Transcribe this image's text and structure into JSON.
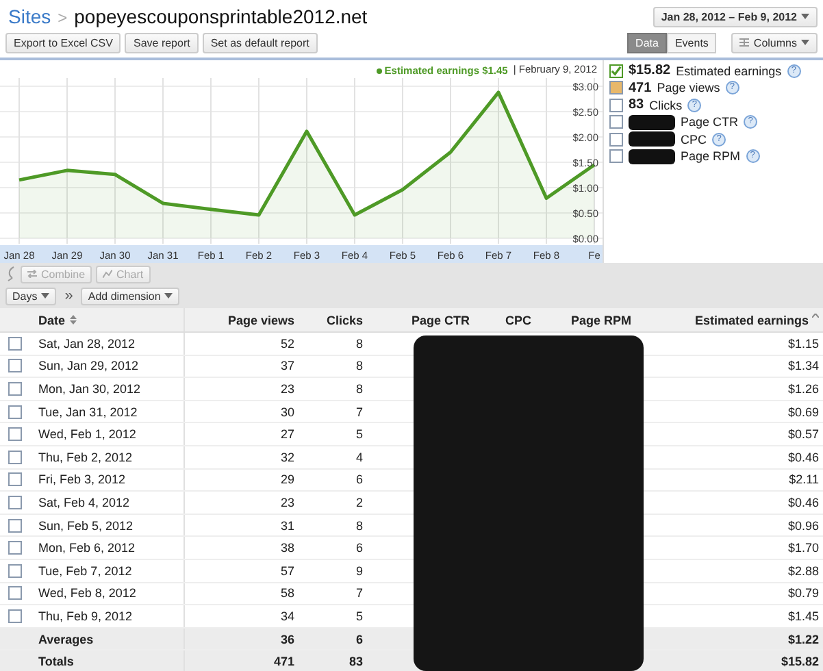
{
  "breadcrumb": {
    "root": "Sites",
    "separator": ">",
    "current": "popeyescouponsprintable2012.net"
  },
  "date_range": "Jan 28, 2012 – Feb 9, 2012",
  "actions": [
    "Export to Excel CSV",
    "Save report",
    "Set as default report"
  ],
  "view_tabs": [
    {
      "label": "Data",
      "selected": true
    },
    {
      "label": "Events",
      "selected": false
    }
  ],
  "columns_menu": "Columns",
  "chart": {
    "tooltip": {
      "value": "$1.45",
      "separator": "|",
      "date": "February 9, 2012"
    },
    "chart_data": {
      "type": "area",
      "grid": true,
      "categories": [
        "Jan 28",
        "Jan 29",
        "Jan 30",
        "Jan 31",
        "Feb 1",
        "Feb 2",
        "Feb 3",
        "Feb 4",
        "Feb 5",
        "Feb 6",
        "Feb 7",
        "Feb 8",
        "Fe"
      ],
      "series": [
        {
          "name": "Estimated earnings",
          "color": "#4e9a26",
          "values": [
            1.15,
            1.34,
            1.26,
            0.69,
            0.57,
            0.46,
            2.11,
            0.46,
            0.96,
            1.7,
            2.88,
            0.79,
            1.45
          ]
        }
      ],
      "ylim": [
        0,
        3
      ],
      "yticks": [
        {
          "value": 0,
          "label": "$0.00"
        },
        {
          "value": 0.5,
          "label": "$0.50"
        },
        {
          "value": 1,
          "label": "$1.00"
        },
        {
          "value": 1.5,
          "label": "$1.50"
        },
        {
          "value": 2,
          "label": "$2.00"
        },
        {
          "value": 2.5,
          "label": "$2.50"
        },
        {
          "value": 3,
          "label": "$3.00"
        }
      ]
    }
  },
  "legend": [
    {
      "value": "$15.82",
      "label": "Estimated earnings",
      "help": "?",
      "checked": true,
      "color": "#4e9a26",
      "redacted": false
    },
    {
      "value": "471",
      "label": "Page views",
      "help": "?",
      "checked": false,
      "color": "#e8b86a",
      "redacted": false
    },
    {
      "value": "83",
      "label": "Clicks",
      "help": "?",
      "checked": false,
      "redacted": false
    },
    {
      "label": "Page CTR",
      "help": "?",
      "checked": false,
      "redacted": true
    },
    {
      "label": "CPC",
      "help": "?",
      "checked": false,
      "redacted": true
    },
    {
      "label": "Page RPM",
      "help": "?",
      "checked": false,
      "redacted": true
    }
  ],
  "toolbar": {
    "combine": {
      "label": "Combine",
      "disabled": true
    },
    "chart": {
      "label": "Chart",
      "disabled": true
    },
    "dimension": "Days",
    "separator": "»",
    "add_dimension": "Add dimension"
  },
  "table": {
    "columns": [
      "Date",
      "Page views",
      "Clicks",
      "Page CTR",
      "CPC",
      "Page RPM",
      "Estimated earnings"
    ],
    "rows": [
      {
        "kind": "day",
        "checked": false,
        "date": "Sat, Jan 28, 2012",
        "page_views": "52",
        "clicks": "8",
        "earnings": "$1.15"
      },
      {
        "kind": "day",
        "checked": false,
        "date": "Sun, Jan 29, 2012",
        "page_views": "37",
        "clicks": "8",
        "earnings": "$1.34"
      },
      {
        "kind": "day",
        "checked": false,
        "date": "Mon, Jan 30, 2012",
        "page_views": "23",
        "clicks": "8",
        "earnings": "$1.26"
      },
      {
        "kind": "day",
        "checked": false,
        "date": "Tue, Jan 31, 2012",
        "page_views": "30",
        "clicks": "7",
        "earnings": "$0.69"
      },
      {
        "kind": "day",
        "checked": false,
        "date": "Wed, Feb 1, 2012",
        "page_views": "27",
        "clicks": "5",
        "earnings": "$0.57"
      },
      {
        "kind": "day",
        "checked": false,
        "date": "Thu, Feb 2, 2012",
        "page_views": "32",
        "clicks": "4",
        "earnings": "$0.46"
      },
      {
        "kind": "day",
        "checked": false,
        "date": "Fri, Feb 3, 2012",
        "page_views": "29",
        "clicks": "6",
        "earnings": "$2.11"
      },
      {
        "kind": "day",
        "checked": false,
        "date": "Sat, Feb 4, 2012",
        "page_views": "23",
        "clicks": "2",
        "earnings": "$0.46"
      },
      {
        "kind": "day",
        "checked": false,
        "date": "Sun, Feb 5, 2012",
        "page_views": "31",
        "clicks": "8",
        "earnings": "$0.96"
      },
      {
        "kind": "day",
        "checked": false,
        "date": "Mon, Feb 6, 2012",
        "page_views": "38",
        "clicks": "6",
        "earnings": "$1.70"
      },
      {
        "kind": "day",
        "checked": false,
        "date": "Tue, Feb 7, 2012",
        "page_views": "57",
        "clicks": "9",
        "earnings": "$2.88"
      },
      {
        "kind": "day",
        "checked": false,
        "date": "Wed, Feb 8, 2012",
        "page_views": "58",
        "clicks": "7",
        "earnings": "$0.79"
      },
      {
        "kind": "day",
        "checked": false,
        "date": "Thu, Feb 9, 2012",
        "page_views": "34",
        "clicks": "5",
        "earnings": "$1.45"
      },
      {
        "kind": "summary",
        "date": "Averages",
        "page_views": "36",
        "clicks": "6",
        "earnings": "$1.22"
      },
      {
        "kind": "summary",
        "date": "Totals",
        "page_views": "471",
        "clicks": "83",
        "earnings": "$15.82"
      }
    ]
  }
}
